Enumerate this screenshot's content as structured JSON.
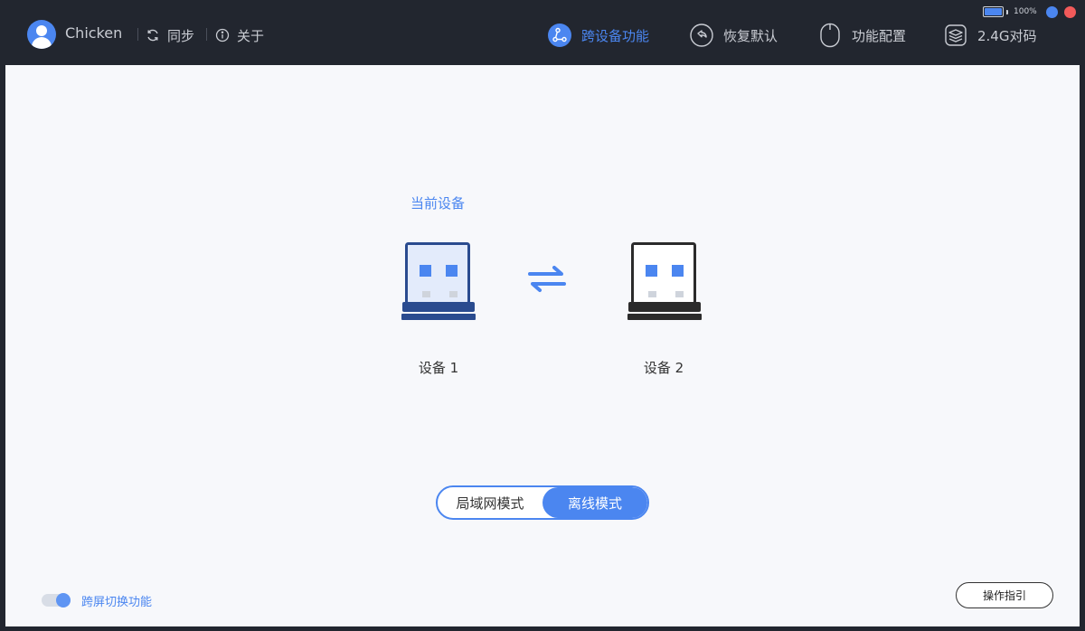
{
  "header": {
    "username": "Chicken",
    "sync_label": "同步",
    "about_label": "关于",
    "nav": [
      {
        "label": "跨设备功能",
        "icon": "cross-device-icon",
        "active": true
      },
      {
        "label": "恢复默认",
        "icon": "restore-default-icon",
        "active": false
      },
      {
        "label": "功能配置",
        "icon": "mouse-config-icon",
        "active": false
      },
      {
        "label": "2.4G对码",
        "icon": "pairing-icon",
        "active": false
      }
    ],
    "battery": {
      "percent_label": "100%",
      "level": 1.0
    },
    "window_dots": {
      "blue": "#4b86f0",
      "red": "#f25a5a"
    }
  },
  "main": {
    "current_device_label": "当前设备",
    "devices": [
      {
        "label": "设备 1",
        "current": true
      },
      {
        "label": "设备 2",
        "current": false
      }
    ],
    "modes": [
      {
        "label": "局域网模式",
        "selected": false
      },
      {
        "label": "离线模式",
        "selected": true
      }
    ],
    "cross_screen_label": "跨屏切换功能",
    "cross_screen_enabled": true,
    "guide_button_label": "操作指引"
  },
  "colors": {
    "accent": "#4b86f0",
    "header_bg": "#22262f",
    "panel_bg": "#f7f8fb"
  }
}
